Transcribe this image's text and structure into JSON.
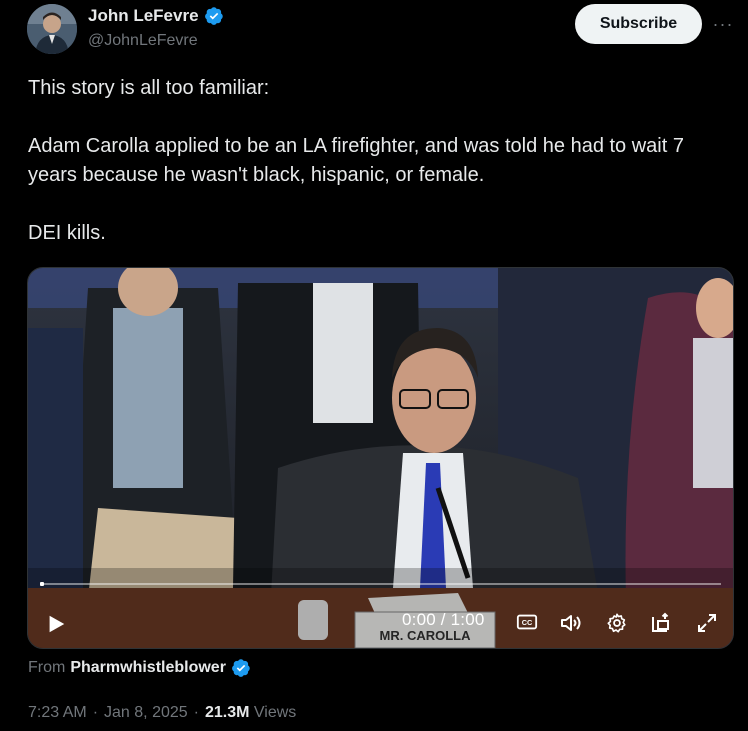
{
  "author": {
    "name": "John LeFevre",
    "handle": "@JohnLeFevre",
    "verified_icon": "verified-badge-icon"
  },
  "actions": {
    "subscribe_label": "Subscribe",
    "more_label": "···"
  },
  "tweet": {
    "line1": "This story is all too familiar:",
    "line2": "Adam Carolla applied to be an LA firefighter, and was told he had to wait 7 years because he wasn't black, hispanic, or female.",
    "line3": "DEI kills."
  },
  "video": {
    "time": "0:00 / 1:00",
    "nameplate": "MR. CAROLLA",
    "progress": 0.0
  },
  "source": {
    "from_label": "From",
    "account": "Pharmwhistleblower"
  },
  "meta": {
    "time": "7:23 AM",
    "date": "Jan 8, 2025",
    "views_count": "21.3M",
    "views_label": "Views",
    "sep": "·"
  },
  "colors": {
    "verified": "#1d9bf0",
    "muted": "#71767b",
    "text": "#e7e9ea"
  }
}
